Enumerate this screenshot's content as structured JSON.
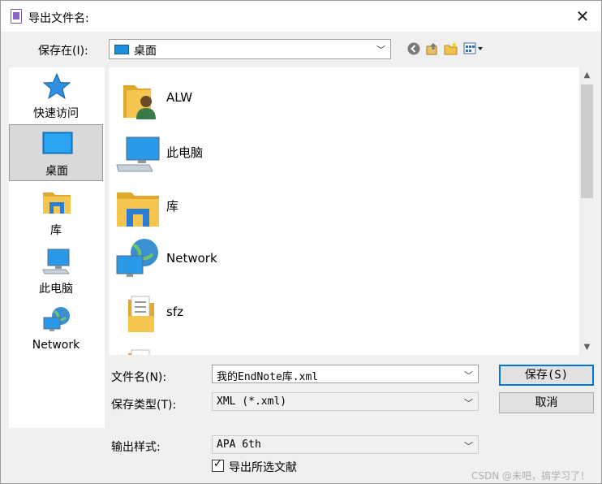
{
  "dialog": {
    "title": "导出文件名:",
    "close_glyph": "✕"
  },
  "save_in": {
    "label": "保存在(I):",
    "value": "桌面"
  },
  "toolbar": {
    "icons": [
      "back-icon",
      "up-folder-icon",
      "new-folder-icon",
      "view-menu-icon"
    ]
  },
  "places": [
    {
      "label": "快速访问",
      "icon": "star-icon"
    },
    {
      "label": "桌面",
      "icon": "desktop-icon"
    },
    {
      "label": "库",
      "icon": "library-icon"
    },
    {
      "label": "此电脑",
      "icon": "computer-icon"
    },
    {
      "label": "Network",
      "icon": "network-icon"
    }
  ],
  "files": [
    {
      "name": "ALW",
      "icon": "user-folder-icon"
    },
    {
      "name": "此电脑",
      "icon": "computer-icon"
    },
    {
      "name": "库",
      "icon": "library-icon"
    },
    {
      "name": "Network",
      "icon": "network-icon"
    },
    {
      "name": "sfz",
      "icon": "folder-documents-icon"
    }
  ],
  "filename": {
    "label": "文件名(N):",
    "value": "我的EndNote库.xml"
  },
  "filetype": {
    "label": "保存类型(T):",
    "value": "XML (*.xml)"
  },
  "output_style": {
    "label": "输出样式:",
    "value": "APA 6th"
  },
  "export_selected": {
    "label": "导出所选文献",
    "checked": true
  },
  "buttons": {
    "save": "保存(S)",
    "cancel": "取消"
  },
  "watermark": "CSDN @未吧，搞学习了！",
  "colors": {
    "accent": "#0078d7",
    "folder": "#f2c14e",
    "desktop": "#1f8fdd"
  }
}
